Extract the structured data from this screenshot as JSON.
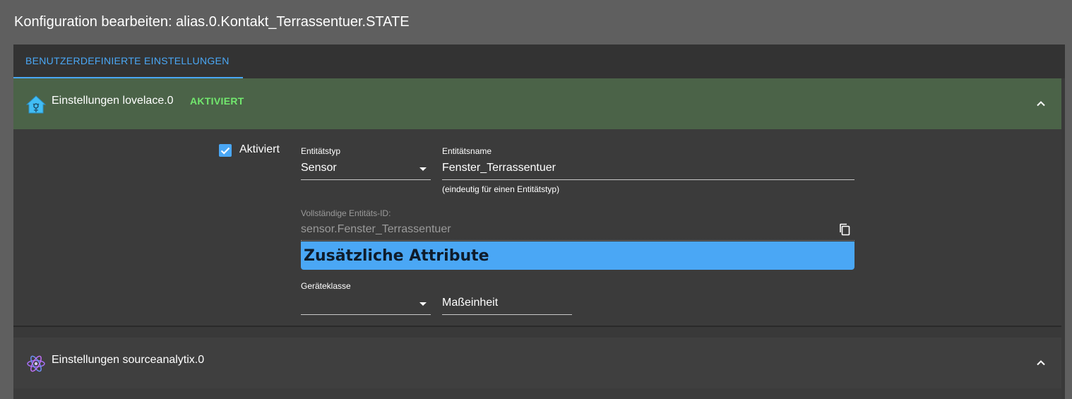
{
  "dialog": {
    "title": "Konfiguration bearbeiten: alias.0.Kontakt_Terrassentuer.STATE"
  },
  "tabs": [
    {
      "label": "BENUTZERDEFINIERTE EINSTELLUNGEN"
    }
  ],
  "sections": [
    {
      "title": "Einstellungen lovelace.0",
      "badge": "AKTIVIERT",
      "icon": "lovelace-house-icon",
      "expanded": true
    },
    {
      "title": "Einstellungen sourceanalytix.0",
      "icon": "sourceanalytix-atom-icon",
      "expanded": true
    }
  ],
  "lovelace": {
    "enabled_label": "Aktiviert",
    "enabled": true,
    "entity_type": {
      "label": "Entitätstyp",
      "value": "Sensor"
    },
    "entity_name": {
      "label": "Entitätsname",
      "value": "Fenster_Terrassentuer",
      "helper": "(eindeutig für einen Entitätstyp)"
    },
    "full_entity_id": {
      "label": "Vollständige Entitäts-ID:",
      "value": "sensor.Fenster_Terrassentuer"
    },
    "attributes_heading": "Zusätzliche Attribute",
    "device_class": {
      "label": "Geräteklasse",
      "value": ""
    },
    "unit": {
      "placeholder": "Maßeinheit",
      "value": ""
    }
  },
  "colors": {
    "background": "#5f5f5f",
    "accent": "#4aa7f5",
    "active_section_header": "#4b6348",
    "badge_green": "#72e86e"
  }
}
